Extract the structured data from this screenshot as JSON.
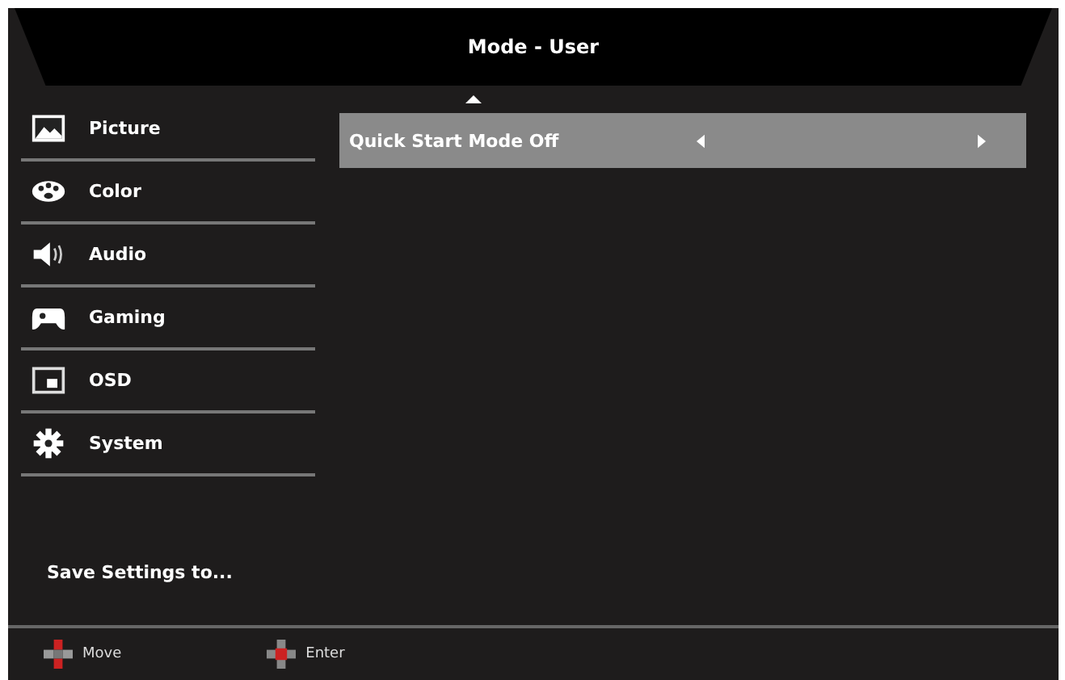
{
  "header": {
    "title": "Mode - User"
  },
  "sidebar": {
    "items": [
      {
        "label": "Picture",
        "kind": "picture"
      },
      {
        "label": "Color",
        "kind": "palette"
      },
      {
        "label": "Audio",
        "kind": "speaker"
      },
      {
        "label": "Gaming",
        "kind": "gamepad"
      },
      {
        "label": "OSD",
        "kind": "osd"
      },
      {
        "label": "System",
        "kind": "gear"
      }
    ],
    "save_label": "Save Settings to..."
  },
  "settings": [
    {
      "label": "Quick Start Mode Off",
      "selected": true
    }
  ],
  "footer": {
    "hints": [
      {
        "label": "Move",
        "kind": "move"
      },
      {
        "label": "Enter",
        "kind": "enter"
      }
    ]
  }
}
